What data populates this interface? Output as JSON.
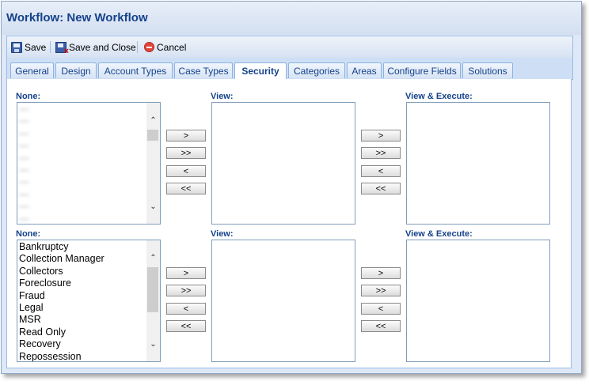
{
  "window": {
    "title": "Workflow: New Workflow"
  },
  "toolbar": {
    "save_label": "Save",
    "save_close_label": "Save and Close",
    "cancel_label": "Cancel"
  },
  "tabs": [
    {
      "label": "General"
    },
    {
      "label": "Design"
    },
    {
      "label": "Account Types"
    },
    {
      "label": "Case Types"
    },
    {
      "label": "Security",
      "active": true
    },
    {
      "label": "Categories"
    },
    {
      "label": "Areas"
    },
    {
      "label": "Configure Fields"
    },
    {
      "label": "Solutions"
    }
  ],
  "sections": [
    {
      "none_label": "None:",
      "view_label": "View:",
      "view_execute_label": "View & Execute:",
      "none_items": [
        "—",
        "—",
        "—",
        "—",
        "—",
        "—",
        "—",
        "—",
        "—",
        "—"
      ],
      "buttons": [
        ">",
        ">>",
        "<",
        "<<"
      ]
    },
    {
      "none_label": "None:",
      "view_label": "View:",
      "view_execute_label": "View & Execute:",
      "none_items": [
        "Bankruptcy",
        "Collection Manager",
        "Collectors",
        "Foreclosure",
        "Fraud",
        "Legal",
        "MSR",
        "Read Only",
        "Recovery",
        "Repossession"
      ],
      "buttons": [
        ">",
        ">>",
        "<",
        "<<"
      ]
    }
  ],
  "icons": {
    "save": "save-icon",
    "save_close": "save-close-icon",
    "cancel": "cancel-icon",
    "scroll_up": "chevron-up-icon",
    "scroll_down": "chevron-down-icon"
  },
  "colors": {
    "title": "#15428b",
    "panel_bg": "#dfe8f6",
    "border": "#99bbe8",
    "cancel_red": "#e0463b"
  }
}
